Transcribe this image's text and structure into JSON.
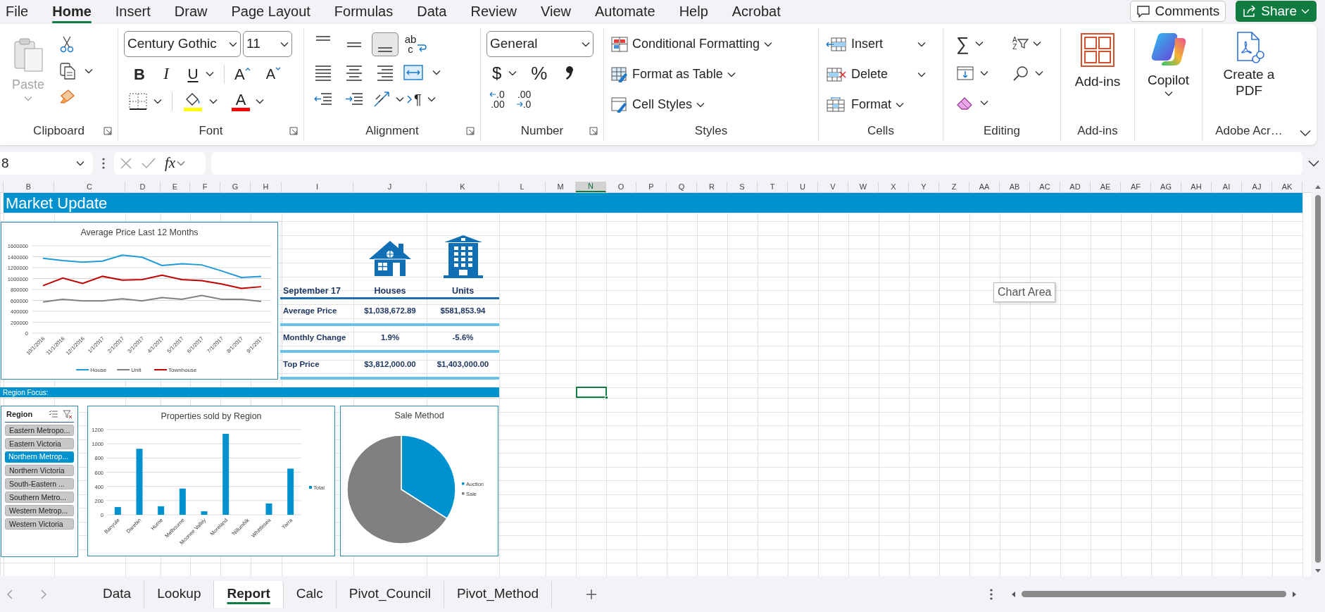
{
  "menu_tabs": [
    {
      "label": "File",
      "selected": false
    },
    {
      "label": "Home",
      "selected": true
    },
    {
      "label": "Insert",
      "selected": false
    },
    {
      "label": "Draw",
      "selected": false
    },
    {
      "label": "Page Layout",
      "selected": false
    },
    {
      "label": "Formulas",
      "selected": false
    },
    {
      "label": "Data",
      "selected": false
    },
    {
      "label": "Review",
      "selected": false
    },
    {
      "label": "View",
      "selected": false
    },
    {
      "label": "Automate",
      "selected": false
    },
    {
      "label": "Help",
      "selected": false
    },
    {
      "label": "Acrobat",
      "selected": false
    }
  ],
  "comments_button": "Comments",
  "share_button": "Share",
  "ribbon": {
    "clipboard": {
      "label": "Clipboard",
      "paste": "Paste"
    },
    "font": {
      "label": "Font",
      "font_name": "Century Gothic",
      "font_size": "11",
      "bold": "B",
      "italic": "I",
      "underline": "U",
      "grow_font": "A",
      "shrink_font": "A",
      "font_color": "A"
    },
    "alignment": {
      "label": "Alignment",
      "vertical_align_buttons": [
        {
          "kind": "top",
          "selected": false
        },
        {
          "kind": "middle",
          "selected": false
        },
        {
          "kind": "bottom",
          "selected": true
        }
      ],
      "wrap_text": [
        "ab",
        "c"
      ],
      "paragraph": "¶"
    },
    "number": {
      "label": "Number",
      "format": "General",
      "currency": "$",
      "percent": "%",
      "increase_decimal": [
        ".0",
        ".00"
      ],
      "decrease_decimal": [
        ".00",
        ".0"
      ]
    },
    "styles": {
      "label": "Styles",
      "items": [
        {
          "kind": "conditional",
          "label": "Conditional Formatting"
        },
        {
          "kind": "table",
          "label": "Format as Table"
        },
        {
          "kind": "cell",
          "label": "Cell Styles"
        }
      ]
    },
    "cells": {
      "label": "Cells",
      "items": [
        {
          "kind": "insert",
          "label": "Insert"
        },
        {
          "kind": "delete",
          "label": "Delete"
        },
        {
          "kind": "format",
          "label": "Format"
        }
      ]
    },
    "editing": {
      "label": "Editing",
      "autosum": "∑",
      "sort_letters": [
        "A",
        "Z"
      ]
    },
    "addins": {
      "label": "Add-ins",
      "button": "Add-ins"
    },
    "copilot": {
      "button": "Copilot"
    },
    "adobe": {
      "label": "Adobe Acr…",
      "button": "Create a PDF"
    }
  },
  "formula_bar": {
    "name_box": "8",
    "function_label": "fx"
  },
  "sheet": {
    "columns": [
      {
        "label": "B",
        "selected": false
      },
      {
        "label": "C",
        "selected": false
      },
      {
        "label": "D",
        "selected": false
      },
      {
        "label": "E",
        "selected": false
      },
      {
        "label": "F",
        "selected": false
      },
      {
        "label": "G",
        "selected": false
      },
      {
        "label": "H",
        "selected": false
      },
      {
        "label": "I",
        "selected": false
      },
      {
        "label": "J",
        "selected": false
      },
      {
        "label": "K",
        "selected": false
      },
      {
        "label": "L",
        "selected": false
      },
      {
        "label": "M",
        "selected": false
      },
      {
        "label": "N",
        "selected": true
      },
      {
        "label": "O",
        "selected": false
      },
      {
        "label": "P",
        "selected": false
      },
      {
        "label": "Q",
        "selected": false
      },
      {
        "label": "R",
        "selected": false
      },
      {
        "label": "S",
        "selected": false
      },
      {
        "label": "T",
        "selected": false
      },
      {
        "label": "U",
        "selected": false
      },
      {
        "label": "V",
        "selected": false
      },
      {
        "label": "W",
        "selected": false
      },
      {
        "label": "X",
        "selected": false
      },
      {
        "label": "Y",
        "selected": false
      },
      {
        "label": "Z",
        "selected": false
      },
      {
        "label": "AA",
        "selected": false
      },
      {
        "label": "AB",
        "selected": false
      },
      {
        "label": "AC",
        "selected": false
      },
      {
        "label": "AD",
        "selected": false
      },
      {
        "label": "AE",
        "selected": false
      },
      {
        "label": "AF",
        "selected": false
      },
      {
        "label": "AG",
        "selected": false
      },
      {
        "label": "AH",
        "selected": false
      },
      {
        "label": "AI",
        "selected": false
      },
      {
        "label": "AJ",
        "selected": false
      },
      {
        "label": "AK",
        "selected": false
      }
    ],
    "banner_title": "Market Update",
    "section_label": "Region Focus:",
    "line_chart": {
      "chart_data": {
        "type": "line",
        "title": "Average Price Last 12 Months",
        "categories": [
          "10/1/2016",
          "11/1/2016",
          "12/1/2016",
          "1/1/2017",
          "2/1/2017",
          "3/1/2017",
          "4/1/2017",
          "5/1/2017",
          "6/1/2017",
          "7/1/2017",
          "8/1/2017",
          "9/1/2017"
        ],
        "series": [
          {
            "name": "House",
            "color": "#1e9ad6",
            "values": [
              1370000,
              1330000,
              1300000,
              1320000,
              1430000,
              1390000,
              1240000,
              1270000,
              1250000,
              1140000,
              1020000,
              1040000
            ]
          },
          {
            "name": "Unit",
            "color": "#808080",
            "values": [
              570000,
              620000,
              590000,
              590000,
              630000,
              590000,
              650000,
              620000,
              690000,
              620000,
              620000,
              580000
            ]
          },
          {
            "name": "Townhouse",
            "color": "#c00000",
            "values": [
              870000,
              1010000,
              910000,
              1040000,
              970000,
              980000,
              1060000,
              980000,
              960000,
              900000,
              820000,
              850000
            ]
          }
        ],
        "ylim": [
          0,
          1600000
        ],
        "yticks": [
          0,
          200000,
          400000,
          600000,
          800000,
          1000000,
          1200000,
          1400000,
          1600000
        ],
        "grid": true,
        "legend": true
      }
    },
    "summary_table": {
      "headers": [
        "September 17",
        "Houses",
        "Units"
      ],
      "rows": [
        {
          "label": "Average Price",
          "values": [
            "$1,038,672.89",
            "$581,853.94"
          ]
        },
        {
          "label": "Monthly Change",
          "values": [
            "1.9%",
            "-5.6%"
          ]
        },
        {
          "label": "Top Price",
          "values": [
            "$3,812,000.00",
            "$1,403,000.00"
          ]
        }
      ]
    },
    "slicer": {
      "title": "Region",
      "items": [
        {
          "label": "Eastern Metropo...",
          "selected": false
        },
        {
          "label": "Eastern Victoria",
          "selected": false
        },
        {
          "label": "Northern Metrop...",
          "selected": true
        },
        {
          "label": "Northern Victoria",
          "selected": false
        },
        {
          "label": "South-Eastern ...",
          "selected": false
        },
        {
          "label": "Southern Metro...",
          "selected": false
        },
        {
          "label": "Western Metrop...",
          "selected": false
        },
        {
          "label": "Western Victoria",
          "selected": false
        }
      ]
    },
    "bar_chart": {
      "chart_data": {
        "type": "bar",
        "title": "Properties sold by Region",
        "categories": [
          "Banyule",
          "Darebin",
          "Hume",
          "Melbourne",
          "Moonee Valley",
          "Moreland",
          "Nillumbik",
          "Whittlesea",
          "Yarra"
        ],
        "series": [
          {
            "name": "Total",
            "color": "#0092cf",
            "values": [
              110,
              930,
              120,
              370,
              50,
              1140,
              0,
              160,
              650
            ]
          }
        ],
        "ylim": [
          0,
          1200
        ],
        "yticks": [
          0,
          200,
          400,
          600,
          800,
          1000,
          1200
        ],
        "grid": true,
        "legend": true
      }
    },
    "pie_chart": {
      "title": "Sale Method",
      "legend": [
        {
          "label": "Auction",
          "color": "#0092cf"
        },
        {
          "label": "Sale",
          "color": "#808080"
        }
      ]
    },
    "tooltip": "Chart Area"
  },
  "sheet_tabs": [
    {
      "label": "Data",
      "selected": false
    },
    {
      "label": "Lookup",
      "selected": false
    },
    {
      "label": "Report",
      "selected": true
    },
    {
      "label": "Calc",
      "selected": false
    },
    {
      "label": "Pivot_Council",
      "selected": false
    },
    {
      "label": "Pivot_Method",
      "selected": false
    }
  ]
}
